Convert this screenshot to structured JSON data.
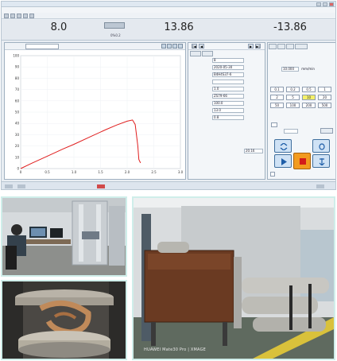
{
  "readouts": {
    "left_value": "8.0",
    "mid_value": "13.86",
    "right_value": "-13.86",
    "small_label": "0%0.2"
  },
  "chart_panel": {
    "tools_count": 4
  },
  "chart_data": {
    "type": "line",
    "xlim": [
      0,
      3
    ],
    "ylim": [
      0,
      100
    ],
    "x_ticks": [
      "0",
      "0.5",
      "1.0",
      "1.5",
      "2.0",
      "2.5",
      "3.0"
    ],
    "y_ticks": [
      "0",
      "10",
      "20",
      "30",
      "40",
      "50",
      "60",
      "70",
      "80",
      "90",
      "100"
    ],
    "x": [
      0.0,
      0.2,
      0.5,
      0.8,
      1.0,
      1.3,
      1.6,
      1.8,
      2.0,
      2.1,
      2.15,
      2.2,
      2.22,
      2.25
    ],
    "y": [
      0.0,
      4.5,
      11.0,
      17.5,
      21.5,
      28.0,
      34.5,
      38.5,
      42.0,
      43.0,
      39.0,
      20.0,
      8.0,
      5.0
    ],
    "color": "#e01e1e"
  },
  "form_panel": {
    "rows": [
      {
        "label": "",
        "value": "8"
      },
      {
        "label": "",
        "value": "2020-05-30"
      },
      {
        "label": "",
        "value": "B4H4S37-6"
      },
      {
        "label": "",
        "value": ""
      },
      {
        "label": "",
        "value": "1.0"
      },
      {
        "label": "",
        "value": "ZS79-66"
      },
      {
        "label": "",
        "value": "100.0"
      },
      {
        "label": "",
        "value": "13.0"
      },
      {
        "label": "",
        "value": "0.8"
      }
    ],
    "extra_value": "20.16"
  },
  "ctrl_panel": {
    "speed_value": "10.000",
    "speed_unit": "mm/min",
    "step_buttons": [
      "0.1",
      "0.2",
      "0.5",
      "1",
      "2",
      "5",
      "10",
      "20",
      "50",
      "100",
      "200",
      "500"
    ],
    "selected_step": "10"
  },
  "photos": {
    "rig_watermark": "HUAWEI Mate30 Pro | XMAGE"
  },
  "colors": {
    "curve": "#e01e1e",
    "photo_border": "#cfeeea",
    "stop_button": "#f29b1f"
  }
}
